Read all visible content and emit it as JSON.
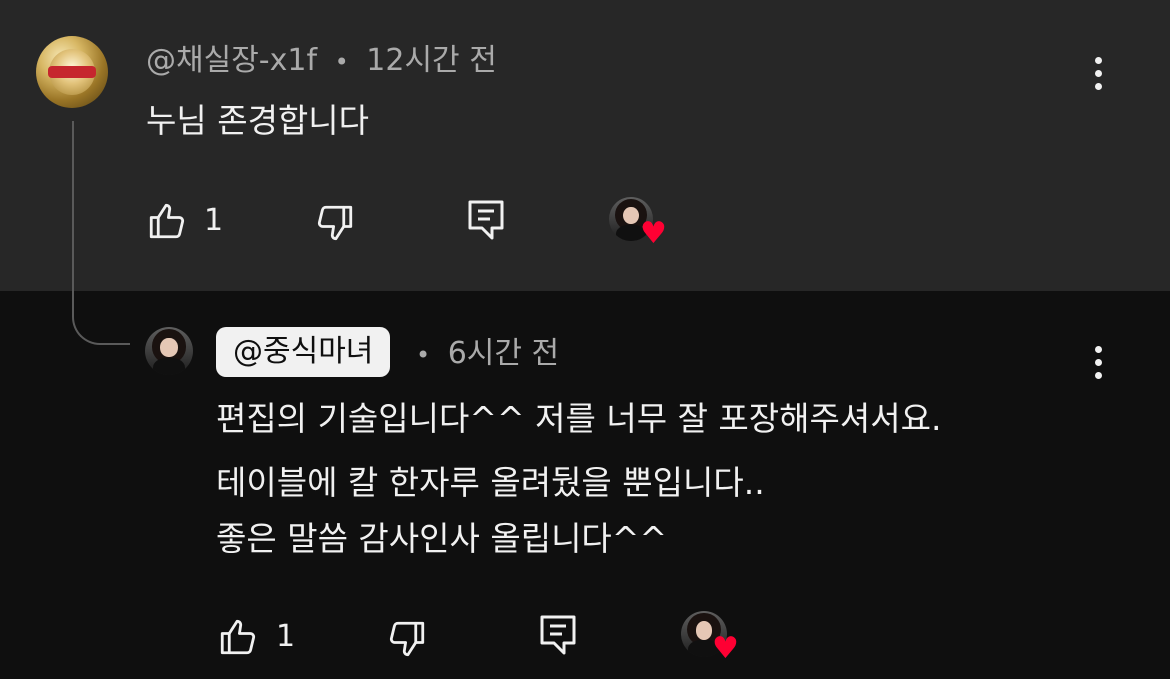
{
  "comment": {
    "handle": "@채실장-x1f",
    "separator": "•",
    "time": "12시간 전",
    "text": "누님 존경합니다",
    "like_count": "1"
  },
  "reply": {
    "handle": "@중식마녀",
    "separator": "•",
    "time": "6시간 전",
    "lines": [
      "편집의 기술입니다^^ 저를 너무 잘 포장해주셔서요.",
      "테이블에 칼 한자루 올려뒀을 뿐입니다..",
      "좋은 말씀 감사인사 올립니다^^"
    ],
    "like_count": "1"
  },
  "icons": {
    "like": "thumb-up-icon",
    "dislike": "thumb-down-icon",
    "reply": "comment-reply-icon",
    "menu": "more-vert-icon",
    "heart": "heart-icon"
  },
  "colors": {
    "top_background": "#272727",
    "reply_background": "#0f0f0f",
    "secondary_text": "#aaaaaa",
    "heart": "#ff0033"
  }
}
